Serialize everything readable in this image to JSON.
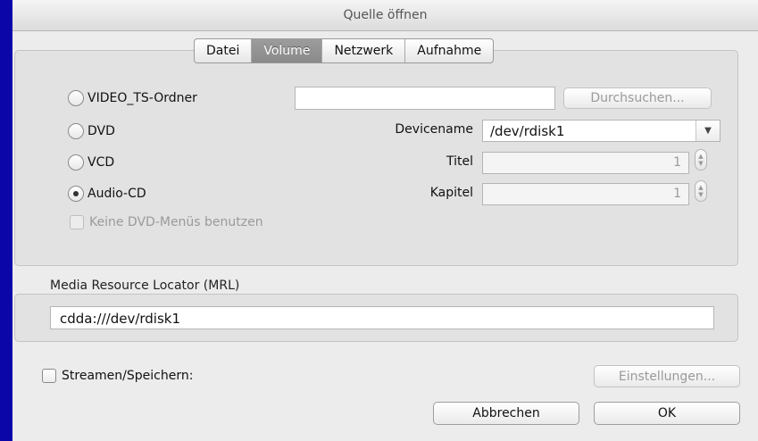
{
  "window": {
    "title": "Quelle öffnen"
  },
  "tabs": [
    {
      "label": "Datei"
    },
    {
      "label": "Volume"
    },
    {
      "label": "Netzwerk"
    },
    {
      "label": "Aufnahme"
    }
  ],
  "selected_tab": "Volume",
  "volume": {
    "options": [
      {
        "label": "VIDEO_TS-Ordner",
        "checked": false
      },
      {
        "label": "DVD",
        "checked": false
      },
      {
        "label": "VCD",
        "checked": false
      },
      {
        "label": "Audio-CD",
        "checked": true
      }
    ],
    "no_menus_label": "Keine DVD-Menüs benutzen",
    "browse_label": "Durchsuchen...",
    "device_label": "Devicename",
    "device_value": "/dev/rdisk1",
    "title_label": "Titel",
    "title_value": "1",
    "chapter_label": "Kapitel",
    "chapter_value": "1"
  },
  "mrl": {
    "label": "Media Resource Locator (MRL)",
    "value": "cdda:///dev/rdisk1"
  },
  "stream": {
    "label": "Streamen/Speichern:",
    "settings_label": "Einstellungen..."
  },
  "buttons": {
    "cancel": "Abbrechen",
    "ok": "OK"
  },
  "icons": {
    "dropdown": "chevron-down-icon",
    "stepper": "stepper-arrows-icon"
  }
}
